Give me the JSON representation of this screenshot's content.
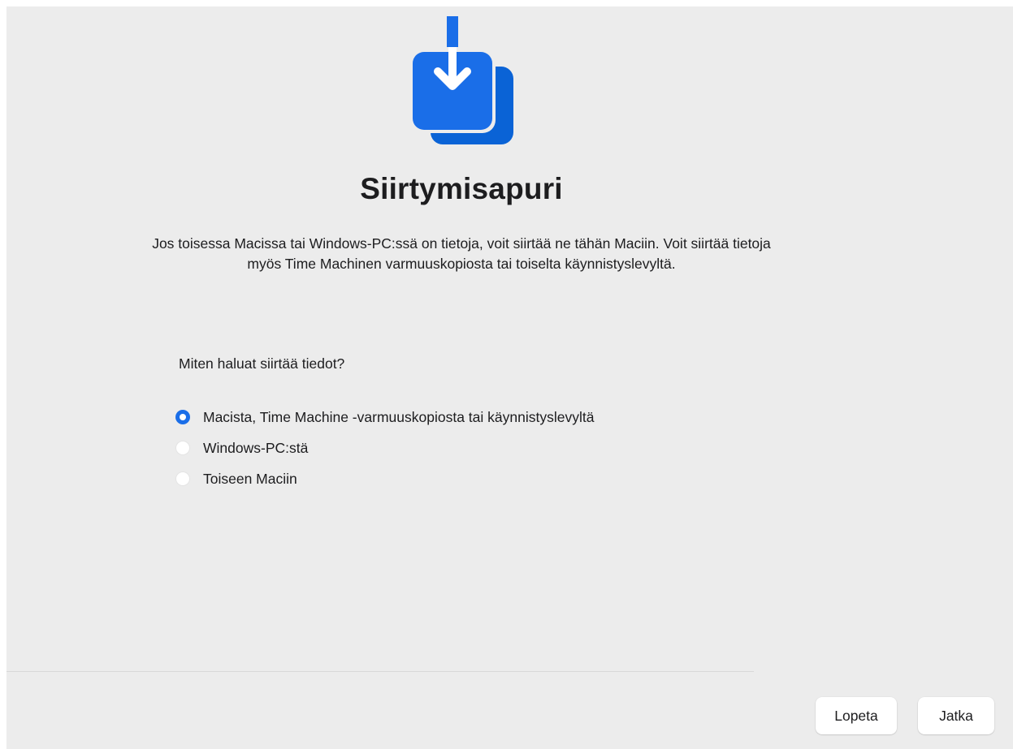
{
  "app": {
    "title": "Siirtymisapuri",
    "icon": "migration-assistant-icon",
    "accent_color": "#1a6ee8"
  },
  "intro": {
    "line1": "Jos toisessa Macissa tai Windows-PC:ssä on tietoja, voit siirtää ne tähän Maciin. Voit siirtää tietoja",
    "line2": "myös Time Machinen varmuuskopiosta tai toiselta käynnistyslevyltä."
  },
  "question": "Miten haluat siirtää tiedot?",
  "options": [
    {
      "label": "Macista, Time Machine -varmuuskopiosta tai käynnistyslevyltä",
      "selected": true
    },
    {
      "label": "Windows-PC:stä",
      "selected": false
    },
    {
      "label": "Toiseen Maciin",
      "selected": false
    }
  ],
  "buttons": {
    "quit": "Lopeta",
    "continue": "Jatka"
  }
}
